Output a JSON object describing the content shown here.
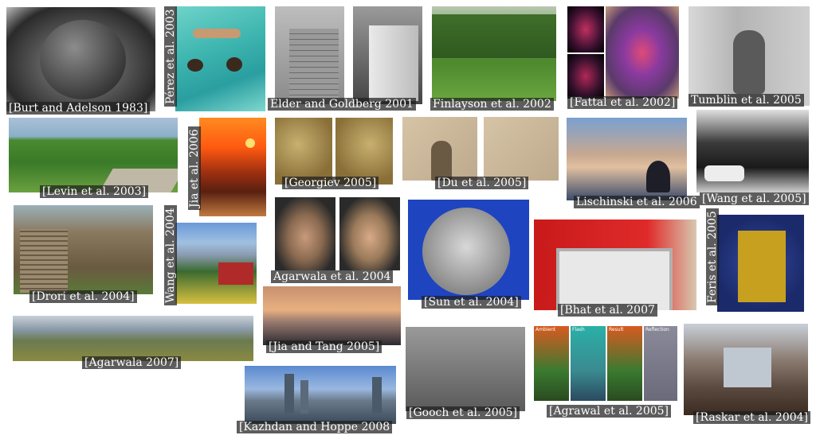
{
  "captions": {
    "burt": "[Burt and Adelson 1983]",
    "perez": "Pérez et al. 2003",
    "elder": "Elder and Goldberg 2001",
    "finlayson": "Finlayson et al. 2002",
    "fattal": "[Fattal et al. 2002]",
    "tumblin": "Tumblin et al. 2005",
    "levin": "[Levin et al. 2003]",
    "jia2006": "Jia et al. 2006",
    "georgiev": "[Georgiev 2005]",
    "du": "[Du et al. 2005]",
    "lischinski": "Lischinski et al. 2006",
    "wang2005": "[Wang et al. 2005]",
    "drori": "[Drori et al. 2004]",
    "wang2004": "Wang et al. 2004",
    "agarwala2004": "Agarwala et al. 2004",
    "sun": "[Sun et al. 2004]",
    "bhat": "[Bhat et al. 2007",
    "feris": "Feris et al. 2005",
    "jiatang": "[Jia and Tang 2005]",
    "agarwala2007": "[Agarwala 2007]",
    "gooch": "[Gooch et al. 2005]",
    "agrawal": "[Agrawal et al. 2005]",
    "raskar": "[Raskar et al. 2004]",
    "kazhdan": "[Kazhdan and Hoppe 2008"
  },
  "agrawal_labels": {
    "ambient": "Ambient",
    "flash": "Flash",
    "result": "Result",
    "reflection": "Reflection"
  },
  "colors": {
    "caption_bg": "#1e1e1e",
    "caption_text": "#ffffff",
    "background": "#ffffff"
  }
}
